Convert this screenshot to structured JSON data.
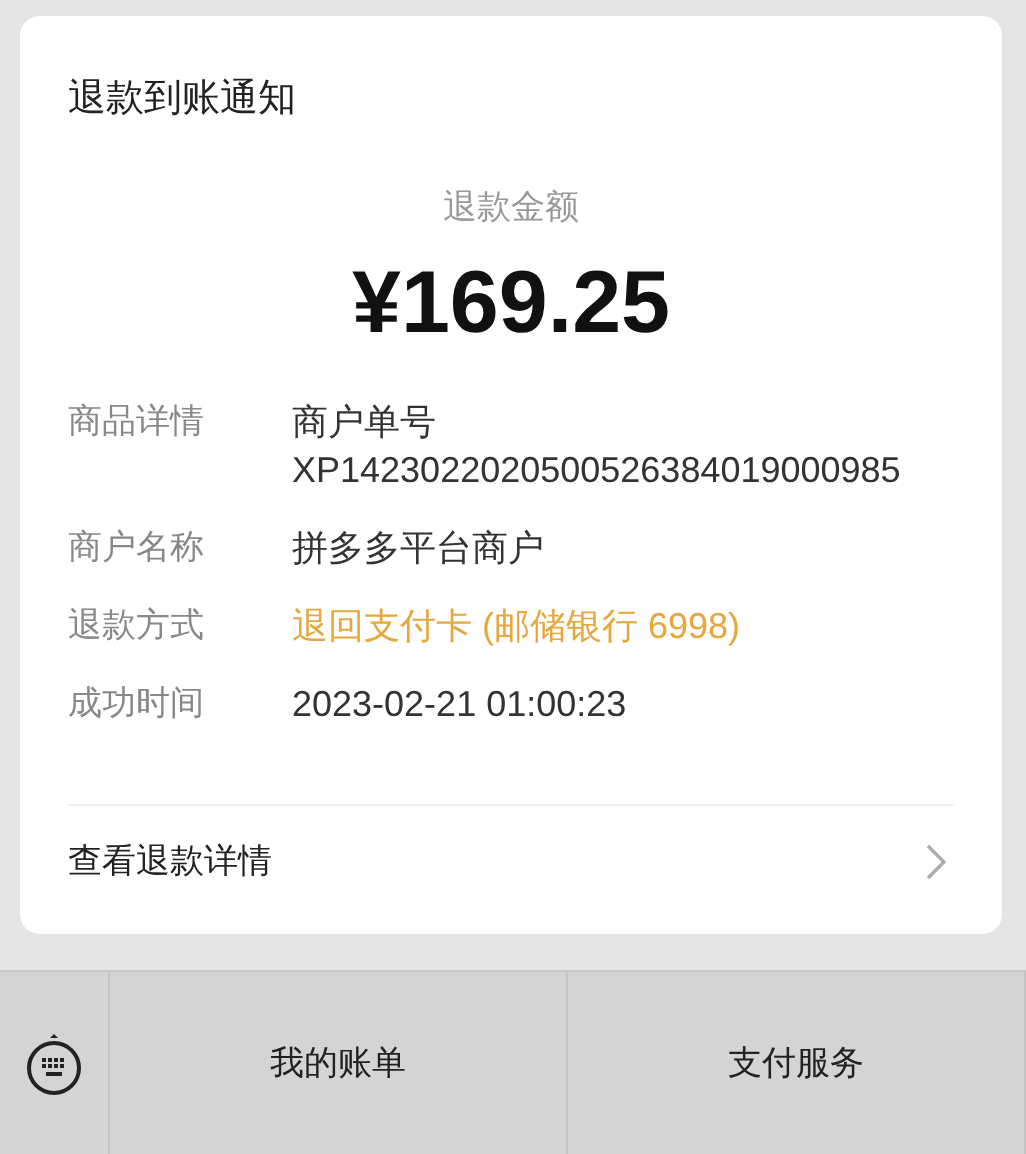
{
  "card": {
    "title": "退款到账通知",
    "amount_label": "退款金额",
    "amount": "¥169.25",
    "rows": [
      {
        "label": "商品详情",
        "values": [
          "商户单号",
          "XP1423022020500526384019000985"
        ],
        "color": "#333333"
      },
      {
        "label": "商户名称",
        "values": [
          "拼多多平台商户"
        ],
        "color": "#333333"
      },
      {
        "label": "退款方式",
        "values": [
          "退回支付卡 (邮储银行 6998)"
        ],
        "color": "#e6a83c"
      },
      {
        "label": "成功时间",
        "values": [
          "2023-02-21 01:00:23"
        ],
        "color": "#333333"
      }
    ],
    "link": "查看退款详情"
  },
  "bottom_bar": {
    "menus": [
      "我的账单",
      "支付服务"
    ]
  }
}
